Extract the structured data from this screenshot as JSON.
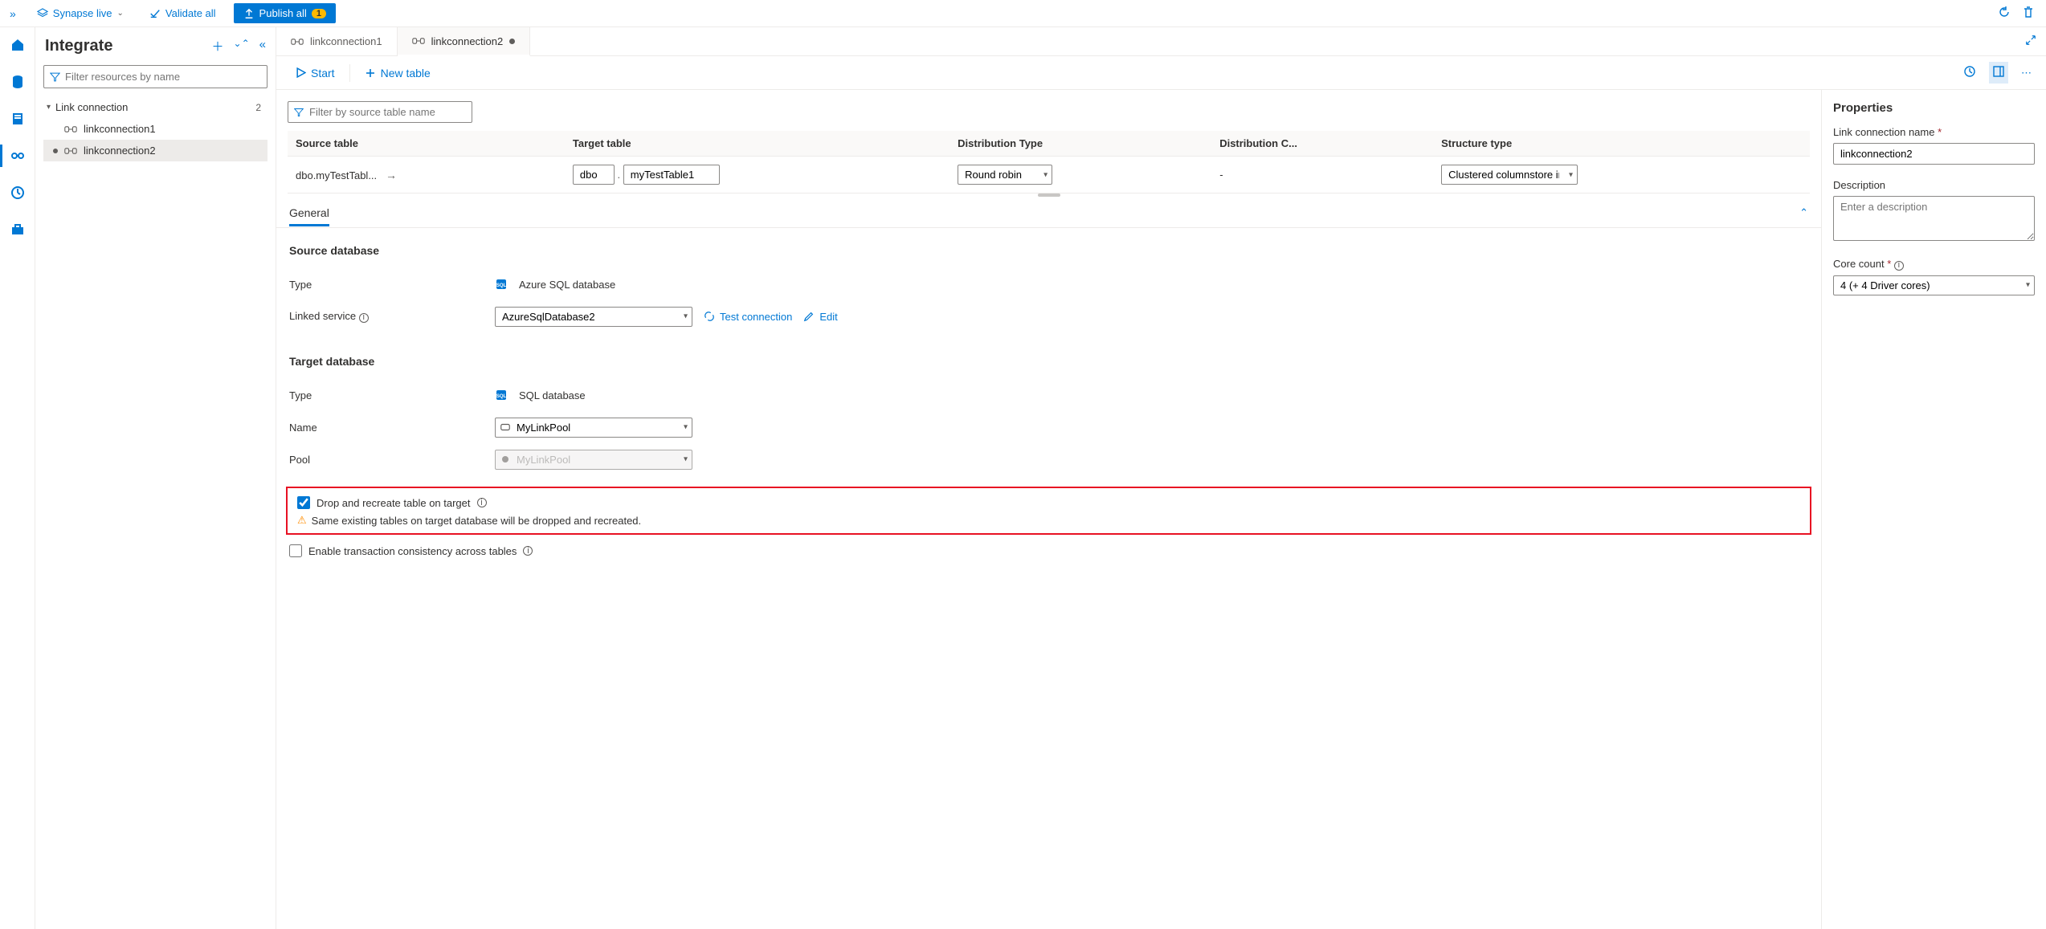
{
  "topbar": {
    "workspace": "Synapse live",
    "validate": "Validate all",
    "publish": "Publish all",
    "publish_count": "1"
  },
  "sidebar": {
    "title": "Integrate",
    "filter_placeholder": "Filter resources by name",
    "group_label": "Link connection",
    "group_count": "2",
    "items": [
      {
        "label": "linkconnection1"
      },
      {
        "label": "linkconnection2"
      }
    ]
  },
  "tabs": [
    {
      "label": "linkconnection1",
      "dirty": false
    },
    {
      "label": "linkconnection2",
      "dirty": true
    }
  ],
  "actionbar": {
    "start": "Start",
    "newtable": "New table"
  },
  "tablegrid": {
    "filter_placeholder": "Filter by source table name",
    "headers": {
      "source": "Source table",
      "target": "Target table",
      "dist_type": "Distribution Type",
      "dist_col": "Distribution C...",
      "struct_type": "Structure type"
    },
    "row": {
      "source": "dbo.myTestTabl...",
      "target_schema": "dbo",
      "target_name": "myTestTable1",
      "dist_type": "Round robin",
      "dist_col": "-",
      "struct_type": "Clustered columnstore ind"
    }
  },
  "accordion": {
    "general": "General"
  },
  "source_db": {
    "heading": "Source database",
    "type_label": "Type",
    "type_value": "Azure SQL database",
    "linked_service_label": "Linked service",
    "linked_service_value": "AzureSqlDatabase2",
    "test_conn": "Test connection",
    "edit": "Edit"
  },
  "target_db": {
    "heading": "Target database",
    "type_label": "Type",
    "type_value": "SQL database",
    "name_label": "Name",
    "name_value": "MyLinkPool",
    "pool_label": "Pool",
    "pool_value": "MyLinkPool"
  },
  "options": {
    "drop_recreate": "Drop and recreate table on target",
    "drop_warning": "Same existing tables on target database will be dropped and recreated.",
    "tx_consistency": "Enable transaction consistency across tables"
  },
  "properties": {
    "heading": "Properties",
    "name_label": "Link connection name",
    "name_value": "linkconnection2",
    "desc_label": "Description",
    "desc_placeholder": "Enter a description",
    "core_label": "Core count",
    "core_value": "4 (+ 4 Driver cores)"
  }
}
